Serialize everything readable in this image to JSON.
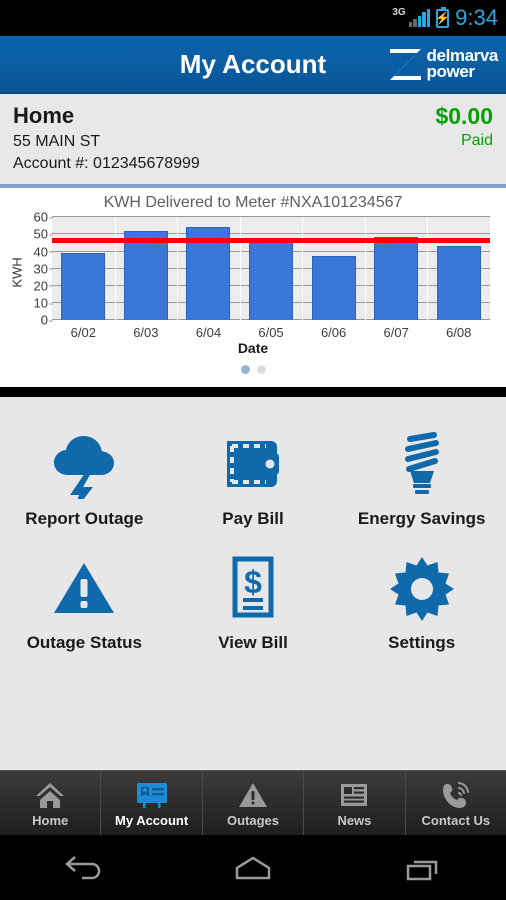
{
  "statusbar": {
    "network": "3G",
    "time": "9:34",
    "battery_icon": "battery-charging-icon",
    "signal_icon": "signal-bars-icon"
  },
  "titlebar": {
    "title": "My Account",
    "logo_line1": "delmarva",
    "logo_line2": "power"
  },
  "account": {
    "nickname": "Home",
    "address": "55 MAIN ST",
    "account_number_label": "Account #: 012345678999",
    "balance": "$0.00",
    "status": "Paid",
    "status_color": "#00a200"
  },
  "chart_data": {
    "type": "bar",
    "title": "KWH Delivered to Meter #NXA101234567",
    "xlabel": "Date",
    "ylabel": "KWH",
    "categories": [
      "6/02",
      "6/03",
      "6/04",
      "6/05",
      "6/06",
      "6/07",
      "6/08"
    ],
    "values": [
      39,
      52,
      54.5,
      46,
      37.5,
      48.5,
      43.5
    ],
    "series": [
      {
        "name": "KWH Delivered",
        "values": [
          39,
          52,
          54.5,
          46,
          37.5,
          48.5,
          43.5
        ],
        "color": "#3a78d8"
      }
    ],
    "threshold_line": {
      "name": "Average",
      "value": 46,
      "color": "#fb0000"
    },
    "ylim": [
      0,
      60
    ],
    "yticks": [
      0,
      10,
      20,
      30,
      40,
      50,
      60
    ],
    "grid": true,
    "legend": "none",
    "bar_color": "#3a78d8",
    "plot_background": "#ececec"
  },
  "pager": {
    "total": 2,
    "active_index": 0
  },
  "grid_items": [
    {
      "label": "Report Outage",
      "icon": "storm-cloud-lightning-icon"
    },
    {
      "label": "Pay Bill",
      "icon": "wallet-icon"
    },
    {
      "label": "Energy Savings",
      "icon": "cfl-bulb-icon"
    },
    {
      "label": "Outage Status",
      "icon": "warning-triangle-icon"
    },
    {
      "label": "View Bill",
      "icon": "bill-document-icon"
    },
    {
      "label": "Settings",
      "icon": "gear-icon"
    }
  ],
  "tabs": [
    {
      "label": "Home",
      "icon": "home-icon",
      "active": false
    },
    {
      "label": "My Account",
      "icon": "id-card-icon",
      "active": true
    },
    {
      "label": "Outages",
      "icon": "warning-triangle-icon",
      "active": false
    },
    {
      "label": "News",
      "icon": "newspaper-icon",
      "active": false
    },
    {
      "label": "Contact Us",
      "icon": "phone-icon",
      "active": false
    }
  ],
  "navbar": [
    {
      "name": "back",
      "icon": "back-arrow-icon"
    },
    {
      "name": "home",
      "icon": "home-pentagon-icon"
    },
    {
      "name": "recents",
      "icon": "recent-apps-icon"
    }
  ],
  "theme": {
    "brand_blue": "#0b5ea3",
    "icon_blue": "#1069ab",
    "card_gray": "#e8e8e8"
  }
}
